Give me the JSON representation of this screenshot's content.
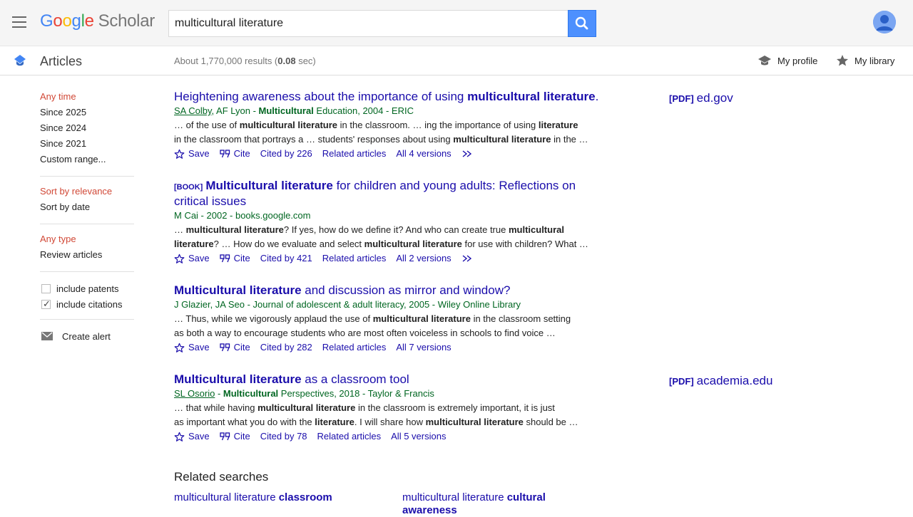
{
  "header": {
    "logo": {
      "letters": [
        "G",
        "o",
        "o",
        "g",
        "l",
        "e"
      ],
      "product": "Scholar"
    },
    "search": {
      "value": "multicultural literature",
      "placeholder": ""
    }
  },
  "subbar": {
    "section_label": "Articles",
    "result_count_prefix": "About 1,770,000 results (",
    "result_time": "0.08",
    "result_count_suffix": " sec)",
    "my_profile": "My profile",
    "my_library": "My library"
  },
  "sidebar": {
    "time": [
      "Any time",
      "Since 2025",
      "Since 2024",
      "Since 2021",
      "Custom range..."
    ],
    "sort": [
      "Sort by relevance",
      "Sort by date"
    ],
    "type": [
      "Any type",
      "Review articles"
    ],
    "include_patents": "include patents",
    "include_citations": "include citations",
    "create_alert": "Create alert"
  },
  "results": [
    {
      "tag": "",
      "title_parts": [
        [
          "Heightening awareness about the importance of using ",
          false
        ],
        [
          "multicultural literature",
          true
        ],
        [
          ".",
          false
        ]
      ],
      "meta_parts": [
        [
          "SA Colby",
          "link"
        ],
        [
          ", AF Lyon - ",
          "plain"
        ],
        [
          "Multicultural",
          "bold"
        ],
        [
          " Education, 2004 - ERIC",
          "plain"
        ]
      ],
      "snippet1": [
        [
          "… of the use of ",
          false
        ],
        [
          "multicultural literature",
          true
        ],
        [
          " in the classroom. … ing the importance of using ",
          false
        ],
        [
          "literature",
          true
        ]
      ],
      "snippet2": [
        [
          "in the classroom that portrays a … students' responses about using ",
          false
        ],
        [
          "multicultural literature",
          true
        ],
        [
          " in the …",
          false
        ]
      ],
      "save": "Save",
      "cite": "Cite",
      "cited_by": "Cited by 226",
      "related": "Related articles",
      "versions": "All 4 versions",
      "more": true,
      "side_tag": "[PDF]",
      "side_source": "ed.gov"
    },
    {
      "tag": "[BOOK]",
      "title_parts": [
        [
          "Multicultural literature",
          true
        ],
        [
          " for children and young adults: Reflections on critical issues",
          false
        ]
      ],
      "meta_parts": [
        [
          "M Cai - 2002 - books.google.com",
          "plain"
        ]
      ],
      "snippet1": [
        [
          "… ",
          false
        ],
        [
          "multicultural literature",
          true
        ],
        [
          "? If yes, how do we define it? And who can create true ",
          false
        ],
        [
          "multicultural",
          true
        ]
      ],
      "snippet2": [
        [
          "literature",
          true
        ],
        [
          "? … How do we evaluate and select ",
          false
        ],
        [
          "multicultural literature",
          true
        ],
        [
          " for use with children? What …",
          false
        ]
      ],
      "save": "Save",
      "cite": "Cite",
      "cited_by": "Cited by 421",
      "related": "Related articles",
      "versions": "All 2 versions",
      "more": true,
      "side_tag": "",
      "side_source": ""
    },
    {
      "tag": "",
      "title_parts": [
        [
          "Multicultural literature",
          true
        ],
        [
          " and discussion as mirror and window?",
          false
        ]
      ],
      "meta_parts": [
        [
          "J Glazier, JA Seo - Journal of adolescent & adult literacy, 2005 - Wiley Online Library",
          "plain"
        ]
      ],
      "snippet1": [
        [
          "… Thus, while we vigorously applaud the use of ",
          false
        ],
        [
          "multicultural literature",
          true
        ],
        [
          " in the classroom setting",
          false
        ]
      ],
      "snippet2": [
        [
          "as both a way to encourage students who are most often voiceless in schools to find voice …",
          false
        ]
      ],
      "save": "Save",
      "cite": "Cite",
      "cited_by": "Cited by 282",
      "related": "Related articles",
      "versions": "All 7 versions",
      "more": false,
      "side_tag": "",
      "side_source": ""
    },
    {
      "tag": "",
      "title_parts": [
        [
          "Multicultural literature",
          true
        ],
        [
          " as a classroom tool",
          false
        ]
      ],
      "meta_parts": [
        [
          "SL Osorio",
          "link"
        ],
        [
          " - ",
          "plain"
        ],
        [
          "Multicultural",
          "bold"
        ],
        [
          " Perspectives, 2018 - Taylor & Francis",
          "plain"
        ]
      ],
      "snippet1": [
        [
          "… that while having ",
          false
        ],
        [
          "multicultural literature",
          true
        ],
        [
          " in the classroom is extremely important, it is just",
          false
        ]
      ],
      "snippet2": [
        [
          "as important what you do with the ",
          false
        ],
        [
          "literature",
          true
        ],
        [
          ". I will share how ",
          false
        ],
        [
          "multicultural literature",
          true
        ],
        [
          " should be …",
          false
        ]
      ],
      "save": "Save",
      "cite": "Cite",
      "cited_by": "Cited by 78",
      "related": "Related articles",
      "versions": "All 5 versions",
      "more": false,
      "side_tag": "[PDF]",
      "side_source": "academia.edu"
    }
  ],
  "related_searches": {
    "title": "Related searches",
    "items": [
      [
        [
          "multicultural literature ",
          false
        ],
        [
          "classroom",
          true
        ]
      ],
      [
        [
          "multicultural literature ",
          false
        ],
        [
          "cultural awareness",
          true
        ]
      ]
    ]
  },
  "colors": {
    "link": "#1a0dab",
    "meta_green": "#006621",
    "active_red": "#d14836",
    "search_blue": "#4d90fe"
  }
}
